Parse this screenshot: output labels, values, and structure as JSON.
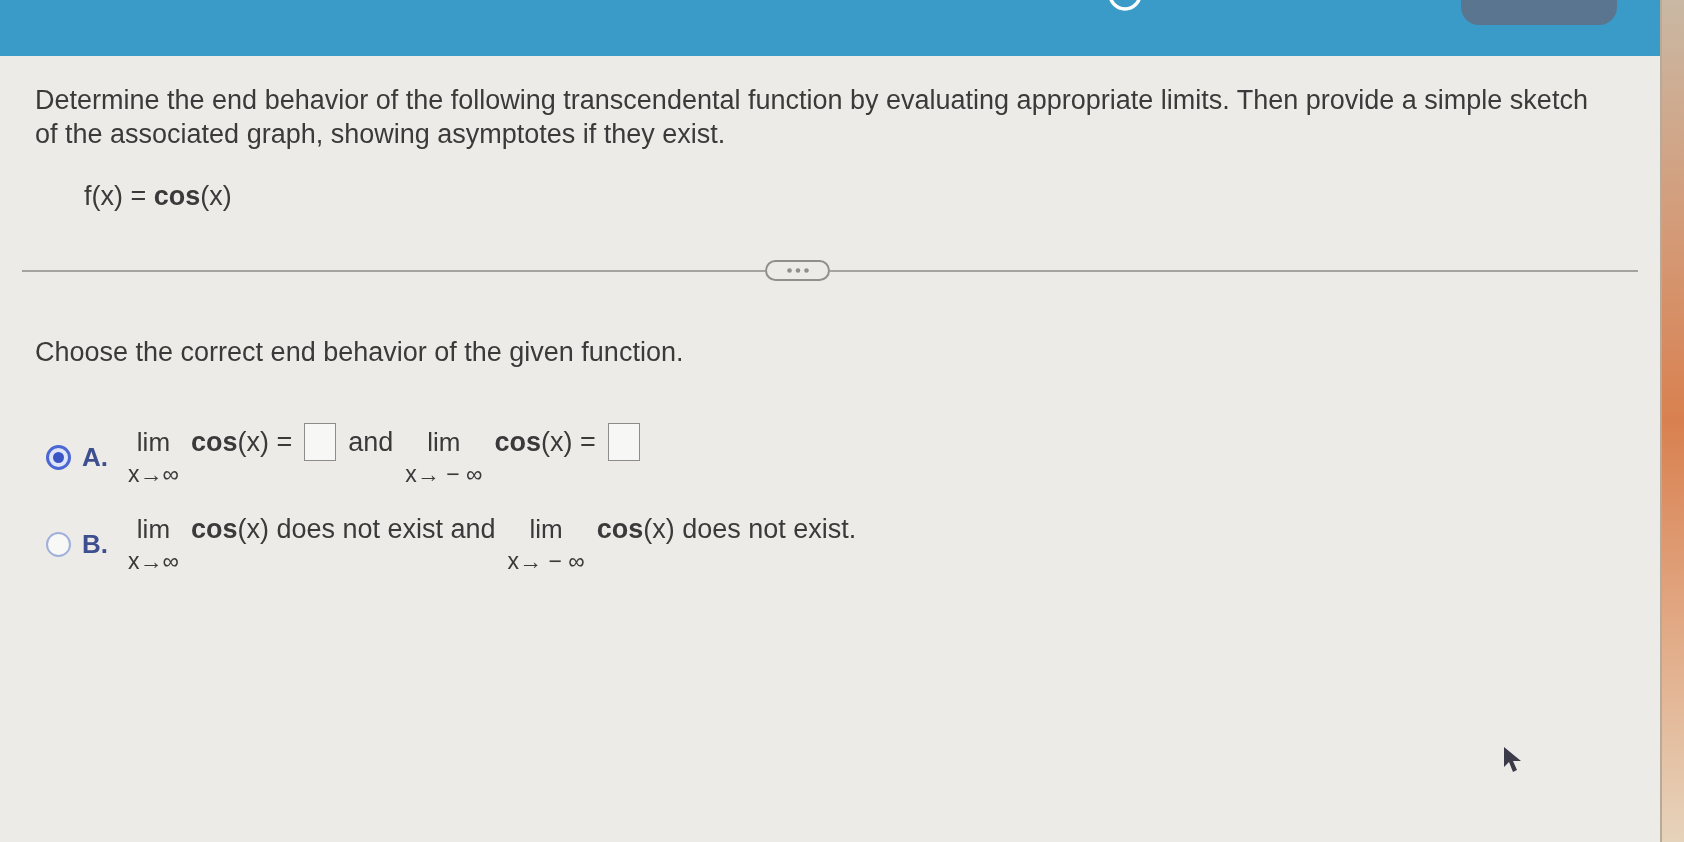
{
  "question": {
    "prompt": "Determine the end behavior of the following transcendental function by evaluating appropriate limits. Then provide a simple sketch of the associated graph, showing asymptotes if they exist.",
    "function": "f(x) = **cos**(x)"
  },
  "instruction": "Choose the correct end behavior of the given function.",
  "options": [
    {
      "letter": "A.",
      "selected": true,
      "parts": [
        {
          "kind": "limit",
          "top": "lim",
          "sub": "x→∞"
        },
        {
          "kind": "text",
          "text": "**cos**(x) ="
        },
        {
          "kind": "box"
        },
        {
          "kind": "text",
          "text": "and"
        },
        {
          "kind": "limit",
          "top": "lim",
          "sub": "x→ − ∞"
        },
        {
          "kind": "text",
          "text": "**cos**(x) ="
        },
        {
          "kind": "box"
        }
      ]
    },
    {
      "letter": "B.",
      "selected": false,
      "parts": [
        {
          "kind": "limit",
          "top": "lim",
          "sub": "x→∞"
        },
        {
          "kind": "text",
          "text": "**cos**(x) does not exist and"
        },
        {
          "kind": "limit",
          "top": "lim",
          "sub": "x→ − ∞"
        },
        {
          "kind": "text",
          "text": "**cos**(x) does not exist."
        }
      ]
    }
  ]
}
